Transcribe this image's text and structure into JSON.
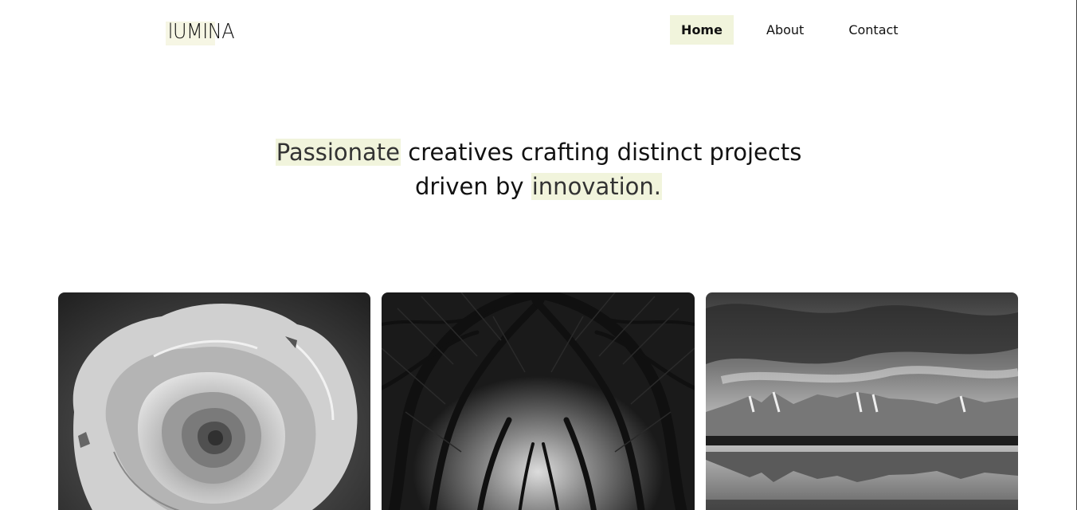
{
  "header": {
    "logo": "lUMINA",
    "nav": [
      {
        "label": "Home",
        "active": true
      },
      {
        "label": "About",
        "active": false
      },
      {
        "label": "Contact",
        "active": false
      }
    ]
  },
  "hero": {
    "line1_highlight": "Passionate",
    "line1_rest": " creatives crafting distinct projects",
    "line2_prefix": "driven by ",
    "line2_highlight": "innovation."
  },
  "gallery": {
    "items": [
      {
        "subject": "rose"
      },
      {
        "subject": "tree-tunnel"
      },
      {
        "subject": "mountain-lake"
      }
    ]
  },
  "colors": {
    "highlight": "#f1f4dc",
    "text": "#111111",
    "background": "#ffffff"
  }
}
